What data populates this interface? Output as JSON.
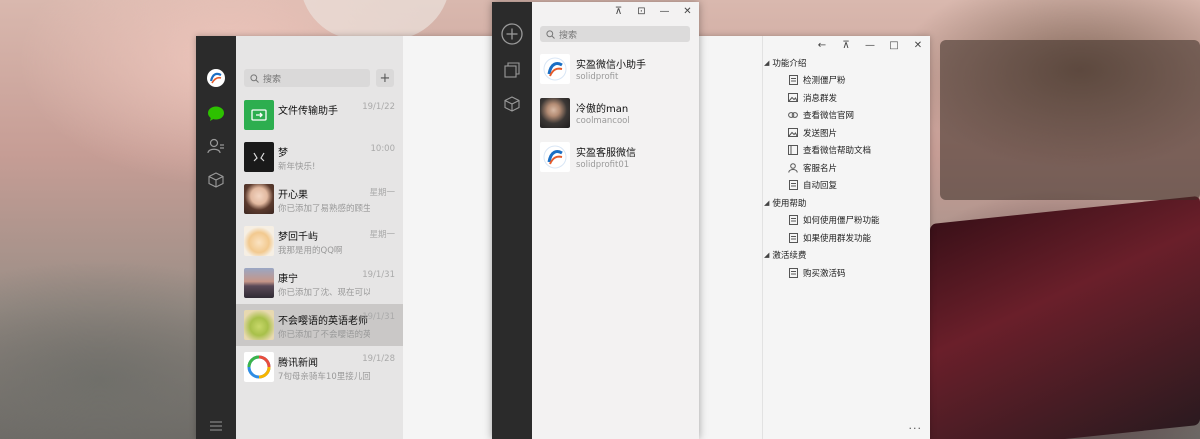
{
  "window_a": {
    "search_placeholder": "搜索",
    "add_label": "+",
    "chats": [
      {
        "name": "文件传输助手",
        "preview": "",
        "time": "19/1/22",
        "avatar": "file-transfer-avatar"
      },
      {
        "name": "梦",
        "preview": "新年快乐!",
        "time": "10:00",
        "avatar": "dream-avatar"
      },
      {
        "name": "开心果",
        "preview": "你已添加了易熟感的顾生...",
        "time": "星期一",
        "avatar": "girl-avatar"
      },
      {
        "name": "梦回千屿",
        "preview": "我那是用的QQ啊",
        "time": "星期一",
        "avatar": "cartoon-avatar"
      },
      {
        "name": "康宁",
        "preview": "你已添加了沈、现在可以...",
        "time": "19/1/31",
        "avatar": "landscape-avatar"
      },
      {
        "name": "不会嘤语的英语老师",
        "preview": "你已添加了不会嘤语的英...",
        "time": "19/1/31",
        "avatar": "frog-avatar"
      },
      {
        "name": "腾讯新闻",
        "preview": "7旬母亲骑车10里接儿回...",
        "time": "19/1/28",
        "avatar": "tencent-news-avatar"
      }
    ],
    "window_controls": {
      "back": "←",
      "pin": "⊼",
      "minimize": "—",
      "maximize": "□",
      "close": "✕"
    },
    "tree": [
      {
        "label": "功能介绍",
        "type": "group"
      },
      {
        "label": "检测僵尸粉",
        "type": "child",
        "icon": "document-icon"
      },
      {
        "label": "消息群发",
        "type": "child",
        "icon": "image-icon"
      },
      {
        "label": "查看微信官网",
        "type": "child",
        "icon": "link-icon"
      },
      {
        "label": "发送图片",
        "type": "child",
        "icon": "image-icon"
      },
      {
        "label": "查看微信帮助文档",
        "type": "child",
        "icon": "book-icon"
      },
      {
        "label": "客服名片",
        "type": "child",
        "icon": "person-icon"
      },
      {
        "label": "自动回复",
        "type": "child",
        "icon": "document-icon"
      },
      {
        "label": "使用帮助",
        "type": "group"
      },
      {
        "label": "如何使用僵尸粉功能",
        "type": "child",
        "icon": "document-icon"
      },
      {
        "label": "如果使用群发功能",
        "type": "child",
        "icon": "document-icon"
      },
      {
        "label": "激活续费",
        "type": "group"
      },
      {
        "label": "购买激活码",
        "type": "child",
        "icon": "document-icon"
      }
    ],
    "more_label": "···"
  },
  "window_b": {
    "search_placeholder": "搜索",
    "window_controls": {
      "pin": "⊼",
      "restore": "⊡",
      "minimize": "—",
      "close": "✕"
    },
    "contacts": [
      {
        "name": "实盈微信小助手",
        "sub": "solidprofit",
        "avatar": "solidprofit-logo"
      },
      {
        "name": "冷傲的man",
        "sub": "coolmancool",
        "avatar": "man-avatar"
      },
      {
        "name": "实盈客服微信",
        "sub": "solidprofit01",
        "avatar": "solidprofit-logo"
      }
    ]
  }
}
